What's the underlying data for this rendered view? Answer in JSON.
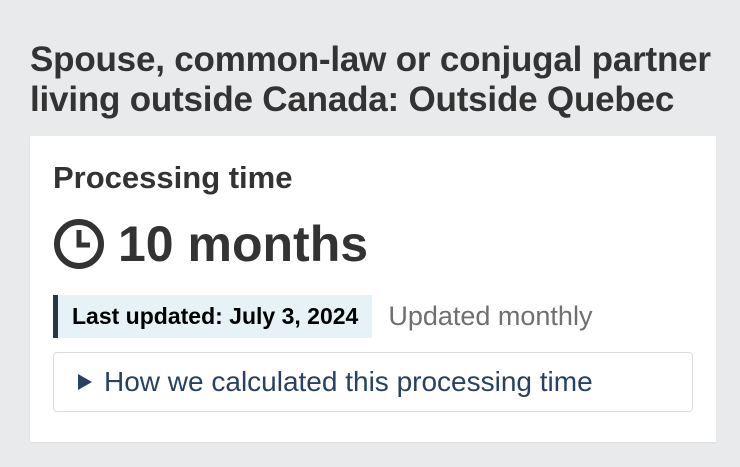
{
  "page": {
    "title": "Spouse, common-law or conjugal partner living outside Canada: Outside Quebec"
  },
  "card": {
    "heading": "Processing time",
    "time_icon": "clock-icon",
    "time_value": "10 months",
    "last_updated": "Last updated: July 3, 2024",
    "update_frequency": "Updated monthly",
    "details": {
      "icon": "triangle-right-icon",
      "label": "How we calculated this processing time",
      "expanded": false
    }
  },
  "colors": {
    "background": "#e9eaec",
    "card": "#ffffff",
    "text": "#333333",
    "badge_background": "#e7f2f6",
    "badge_border": "#26374a",
    "link": "#284162",
    "muted": "#6f6f6f"
  }
}
